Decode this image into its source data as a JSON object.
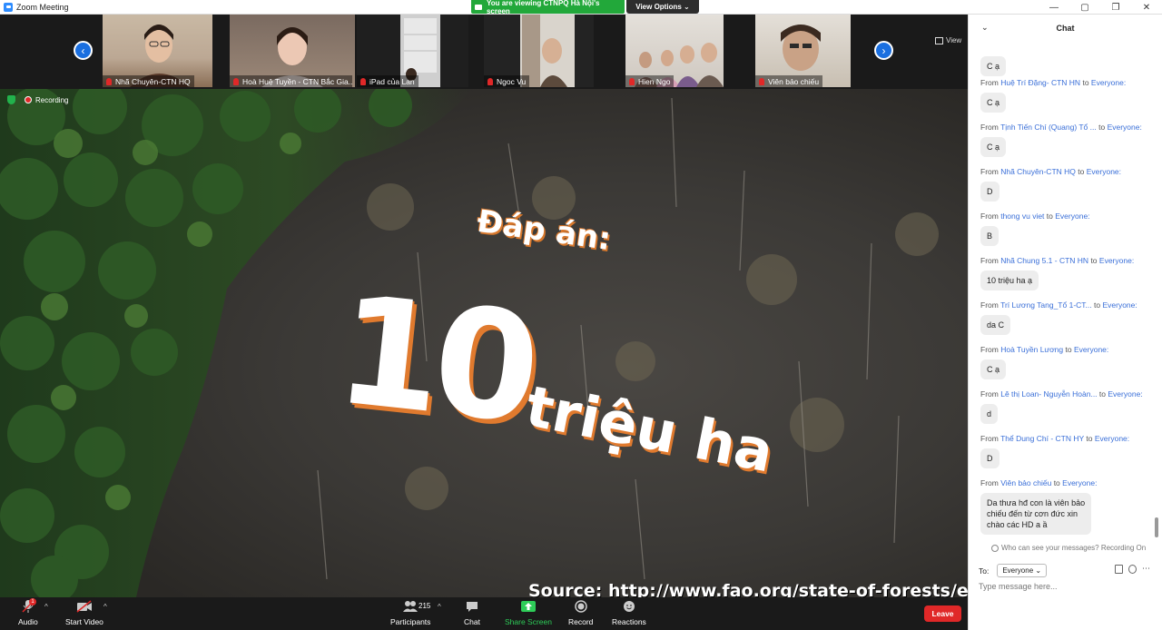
{
  "window": {
    "title": "Zoom Meeting",
    "controls": [
      "—",
      "▢",
      "❐",
      "✕"
    ]
  },
  "banner": {
    "viewing": "You are viewing CTNPQ Hà Nội's screen",
    "view_options": "View Options ⌄"
  },
  "strip": {
    "view_label": "View",
    "participants": [
      {
        "name": "Nhã Chuyên-CTN HQ"
      },
      {
        "name": "Hoà Huệ Tuyền - CTN Bắc Gia..."
      },
      {
        "name": "iPad của Lan"
      },
      {
        "name": "Ngoc Vu"
      },
      {
        "name": "Hien Ngo"
      },
      {
        "name": "Viên bảo chiếu"
      }
    ]
  },
  "share": {
    "recording": "Recording",
    "slide": {
      "answer_label": "Đáp án:",
      "number": "10",
      "unit": "triệu ha",
      "source": "Source: http://www.fao.org/state-of-forests/en/"
    }
  },
  "toolbar": {
    "audio": "Audio",
    "start_video": "Start Video",
    "participants_count": "215",
    "participants": "Participants",
    "chat": "Chat",
    "share_screen": "Share Screen",
    "record": "Record",
    "reactions": "Reactions",
    "leave": "Leave",
    "audio_badge": "1"
  },
  "chat": {
    "title": "Chat",
    "first_bubble": "C ạ",
    "messages": [
      {
        "from": "Huệ Trí Đặng- CTN HN",
        "to": "Everyone:",
        "text": "C ạ"
      },
      {
        "from": "Tịnh Tiến Chí (Quang) Tổ ...",
        "to": "Everyone:",
        "text": "C ạ"
      },
      {
        "from": "Nhã Chuyên-CTN HQ",
        "to": "Everyone:",
        "text": "D"
      },
      {
        "from": "thong vu viet",
        "to": "Everyone:",
        "text": "B"
      },
      {
        "from": "Nhã Chung 5.1 - CTN HN",
        "to": "Everyone:",
        "text": "10 triệu ha ạ"
      },
      {
        "from": "Trí Lương Tang_Tổ 1-CT...",
        "to": "Everyone:",
        "text": "da C"
      },
      {
        "from": "Hoà Tuyền Lương",
        "to": "Everyone:",
        "text": "C ạ"
      },
      {
        "from": "Lê thị Loan- Nguyễn Hoàn...",
        "to": "Everyone:",
        "text": "d"
      },
      {
        "from": "Thể Dung Chí - CTN HY",
        "to": "Everyone:",
        "text": "D"
      },
      {
        "from": "Viên bảo chiếu",
        "to": "Everyone:",
        "text": "Da thưa hđ con là viên bảo\nchiếu đến từ cơn đức  xin\nchào các HD a ầ"
      }
    ],
    "from_word": "From",
    "to_word": "to",
    "who_can_see": "Who can see your messages? Recording On",
    "to_label": "To:",
    "recipient": "Everyone ⌄",
    "input_placeholder": "Type message here..."
  },
  "colors": {
    "accent": "#2d8cff",
    "green": "#22a83a",
    "leave": "#e02828",
    "slide_orange": "#e07a2e"
  }
}
